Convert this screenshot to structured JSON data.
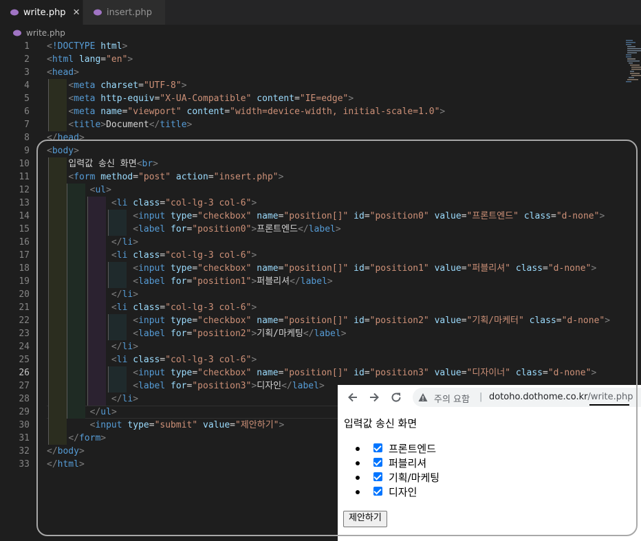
{
  "tabs": [
    {
      "label": "write.php",
      "active": true
    },
    {
      "label": "insert.php",
      "active": false
    }
  ],
  "breadcrumb": "write.php",
  "code": [
    [
      [
        "p",
        "<"
      ],
      [
        "t",
        "!DOCTYPE"
      ],
      [
        "x",
        " "
      ],
      [
        "a",
        "html"
      ],
      [
        "p",
        ">"
      ]
    ],
    [
      [
        "p",
        "<"
      ],
      [
        "t",
        "html"
      ],
      [
        "x",
        " "
      ],
      [
        "a",
        "lang"
      ],
      [
        "x",
        "="
      ],
      [
        "s",
        "\"en\""
      ],
      [
        "p",
        ">"
      ]
    ],
    [
      [
        "p",
        "<"
      ],
      [
        "t",
        "head"
      ],
      [
        "p",
        ">"
      ]
    ],
    [
      [
        "x",
        "    "
      ],
      [
        "p",
        "<"
      ],
      [
        "t",
        "meta"
      ],
      [
        "x",
        " "
      ],
      [
        "a",
        "charset"
      ],
      [
        "x",
        "="
      ],
      [
        "s",
        "\"UTF-8\""
      ],
      [
        "p",
        ">"
      ]
    ],
    [
      [
        "x",
        "    "
      ],
      [
        "p",
        "<"
      ],
      [
        "t",
        "meta"
      ],
      [
        "x",
        " "
      ],
      [
        "a",
        "http-equiv"
      ],
      [
        "x",
        "="
      ],
      [
        "s",
        "\"X-UA-Compatible\""
      ],
      [
        "x",
        " "
      ],
      [
        "a",
        "content"
      ],
      [
        "x",
        "="
      ],
      [
        "s",
        "\"IE=edge\""
      ],
      [
        "p",
        ">"
      ]
    ],
    [
      [
        "x",
        "    "
      ],
      [
        "p",
        "<"
      ],
      [
        "t",
        "meta"
      ],
      [
        "x",
        " "
      ],
      [
        "a",
        "name"
      ],
      [
        "x",
        "="
      ],
      [
        "s",
        "\"viewport\""
      ],
      [
        "x",
        " "
      ],
      [
        "a",
        "content"
      ],
      [
        "x",
        "="
      ],
      [
        "s",
        "\"width=device-width, initial-scale=1.0\""
      ],
      [
        "p",
        ">"
      ]
    ],
    [
      [
        "x",
        "    "
      ],
      [
        "p",
        "<"
      ],
      [
        "t",
        "title"
      ],
      [
        "p",
        ">"
      ],
      [
        "x",
        "Document"
      ],
      [
        "p",
        "</"
      ],
      [
        "t",
        "title"
      ],
      [
        "p",
        ">"
      ]
    ],
    [
      [
        "p",
        "</"
      ],
      [
        "t",
        "head"
      ],
      [
        "p",
        ">"
      ]
    ],
    [
      [
        "p",
        "<"
      ],
      [
        "t",
        "body"
      ],
      [
        "p",
        ">"
      ]
    ],
    [
      [
        "x",
        "    입력값 송신 화면"
      ],
      [
        "p",
        "<"
      ],
      [
        "t",
        "br"
      ],
      [
        "p",
        ">"
      ]
    ],
    [
      [
        "x",
        "    "
      ],
      [
        "p",
        "<"
      ],
      [
        "t",
        "form"
      ],
      [
        "x",
        " "
      ],
      [
        "a",
        "method"
      ],
      [
        "x",
        "="
      ],
      [
        "s",
        "\"post\""
      ],
      [
        "x",
        " "
      ],
      [
        "a",
        "action"
      ],
      [
        "x",
        "="
      ],
      [
        "s",
        "\"insert.php\""
      ],
      [
        "p",
        ">"
      ]
    ],
    [
      [
        "x",
        "        "
      ],
      [
        "p",
        "<"
      ],
      [
        "t",
        "ul"
      ],
      [
        "p",
        ">"
      ]
    ],
    [
      [
        "x",
        "            "
      ],
      [
        "p",
        "<"
      ],
      [
        "t",
        "li"
      ],
      [
        "x",
        " "
      ],
      [
        "a",
        "class"
      ],
      [
        "x",
        "="
      ],
      [
        "s",
        "\"col-lg-3 col-6\""
      ],
      [
        "p",
        ">"
      ]
    ],
    [
      [
        "x",
        "                "
      ],
      [
        "p",
        "<"
      ],
      [
        "t",
        "input"
      ],
      [
        "x",
        " "
      ],
      [
        "a",
        "type"
      ],
      [
        "x",
        "="
      ],
      [
        "s",
        "\"checkbox\""
      ],
      [
        "x",
        " "
      ],
      [
        "a",
        "name"
      ],
      [
        "x",
        "="
      ],
      [
        "s",
        "\"position[]\""
      ],
      [
        "x",
        " "
      ],
      [
        "a",
        "id"
      ],
      [
        "x",
        "="
      ],
      [
        "s",
        "\"position0\""
      ],
      [
        "x",
        " "
      ],
      [
        "a",
        "value"
      ],
      [
        "x",
        "="
      ],
      [
        "s",
        "\"프론트엔드\""
      ],
      [
        "x",
        " "
      ],
      [
        "a",
        "class"
      ],
      [
        "x",
        "="
      ],
      [
        "s",
        "\"d-none\""
      ],
      [
        "p",
        ">"
      ]
    ],
    [
      [
        "x",
        "                "
      ],
      [
        "p",
        "<"
      ],
      [
        "t",
        "label"
      ],
      [
        "x",
        " "
      ],
      [
        "a",
        "for"
      ],
      [
        "x",
        "="
      ],
      [
        "s",
        "\"position0\""
      ],
      [
        "p",
        ">"
      ],
      [
        "x",
        "프론트엔드"
      ],
      [
        "p",
        "</"
      ],
      [
        "t",
        "label"
      ],
      [
        "p",
        ">"
      ]
    ],
    [
      [
        "x",
        "            "
      ],
      [
        "p",
        "</"
      ],
      [
        "t",
        "li"
      ],
      [
        "p",
        ">"
      ]
    ],
    [
      [
        "x",
        "            "
      ],
      [
        "p",
        "<"
      ],
      [
        "t",
        "li"
      ],
      [
        "x",
        " "
      ],
      [
        "a",
        "class"
      ],
      [
        "x",
        "="
      ],
      [
        "s",
        "\"col-lg-3 col-6\""
      ],
      [
        "p",
        ">"
      ]
    ],
    [
      [
        "x",
        "                "
      ],
      [
        "p",
        "<"
      ],
      [
        "t",
        "input"
      ],
      [
        "x",
        " "
      ],
      [
        "a",
        "type"
      ],
      [
        "x",
        "="
      ],
      [
        "s",
        "\"checkbox\""
      ],
      [
        "x",
        " "
      ],
      [
        "a",
        "name"
      ],
      [
        "x",
        "="
      ],
      [
        "s",
        "\"position[]\""
      ],
      [
        "x",
        " "
      ],
      [
        "a",
        "id"
      ],
      [
        "x",
        "="
      ],
      [
        "s",
        "\"position1\""
      ],
      [
        "x",
        " "
      ],
      [
        "a",
        "value"
      ],
      [
        "x",
        "="
      ],
      [
        "s",
        "\"퍼블리셔\""
      ],
      [
        "x",
        " "
      ],
      [
        "a",
        "class"
      ],
      [
        "x",
        "="
      ],
      [
        "s",
        "\"d-none\""
      ],
      [
        "p",
        ">"
      ]
    ],
    [
      [
        "x",
        "                "
      ],
      [
        "p",
        "<"
      ],
      [
        "t",
        "label"
      ],
      [
        "x",
        " "
      ],
      [
        "a",
        "for"
      ],
      [
        "x",
        "="
      ],
      [
        "s",
        "\"position1\""
      ],
      [
        "p",
        ">"
      ],
      [
        "x",
        "퍼블리셔"
      ],
      [
        "p",
        "</"
      ],
      [
        "t",
        "label"
      ],
      [
        "p",
        ">"
      ]
    ],
    [
      [
        "x",
        "            "
      ],
      [
        "p",
        "</"
      ],
      [
        "t",
        "li"
      ],
      [
        "p",
        ">"
      ]
    ],
    [
      [
        "x",
        "            "
      ],
      [
        "p",
        "<"
      ],
      [
        "t",
        "li"
      ],
      [
        "x",
        " "
      ],
      [
        "a",
        "class"
      ],
      [
        "x",
        "="
      ],
      [
        "s",
        "\"col-lg-3 col-6\""
      ],
      [
        "p",
        ">"
      ]
    ],
    [
      [
        "x",
        "                "
      ],
      [
        "p",
        "<"
      ],
      [
        "t",
        "input"
      ],
      [
        "x",
        " "
      ],
      [
        "a",
        "type"
      ],
      [
        "x",
        "="
      ],
      [
        "s",
        "\"checkbox\""
      ],
      [
        "x",
        " "
      ],
      [
        "a",
        "name"
      ],
      [
        "x",
        "="
      ],
      [
        "s",
        "\"position[]\""
      ],
      [
        "x",
        " "
      ],
      [
        "a",
        "id"
      ],
      [
        "x",
        "="
      ],
      [
        "s",
        "\"position2\""
      ],
      [
        "x",
        " "
      ],
      [
        "a",
        "value"
      ],
      [
        "x",
        "="
      ],
      [
        "s",
        "\"기획/마케터\""
      ],
      [
        "x",
        " "
      ],
      [
        "a",
        "class"
      ],
      [
        "x",
        "="
      ],
      [
        "s",
        "\"d-none\""
      ],
      [
        "p",
        ">"
      ]
    ],
    [
      [
        "x",
        "                "
      ],
      [
        "p",
        "<"
      ],
      [
        "t",
        "label"
      ],
      [
        "x",
        " "
      ],
      [
        "a",
        "for"
      ],
      [
        "x",
        "="
      ],
      [
        "s",
        "\"position2\""
      ],
      [
        "p",
        ">"
      ],
      [
        "x",
        "기획/마케팅"
      ],
      [
        "p",
        "</"
      ],
      [
        "t",
        "label"
      ],
      [
        "p",
        ">"
      ]
    ],
    [
      [
        "x",
        "            "
      ],
      [
        "p",
        "</"
      ],
      [
        "t",
        "li"
      ],
      [
        "p",
        ">"
      ]
    ],
    [
      [
        "x",
        "            "
      ],
      [
        "p",
        "<"
      ],
      [
        "t",
        "li"
      ],
      [
        "x",
        " "
      ],
      [
        "a",
        "class"
      ],
      [
        "x",
        "="
      ],
      [
        "s",
        "\"col-lg-3 col-6\""
      ],
      [
        "p",
        ">"
      ]
    ],
    [
      [
        "x",
        "                "
      ],
      [
        "p",
        "<"
      ],
      [
        "t",
        "input"
      ],
      [
        "x",
        " "
      ],
      [
        "a",
        "type"
      ],
      [
        "x",
        "="
      ],
      [
        "s",
        "\"checkbox\""
      ],
      [
        "x",
        " "
      ],
      [
        "a",
        "name"
      ],
      [
        "x",
        "="
      ],
      [
        "s",
        "\"position[]\""
      ],
      [
        "x",
        " "
      ],
      [
        "a",
        "id"
      ],
      [
        "x",
        "="
      ],
      [
        "s",
        "\"position3\""
      ],
      [
        "x",
        " "
      ],
      [
        "a",
        "value"
      ],
      [
        "x",
        "="
      ],
      [
        "s",
        "\"디자이너\""
      ],
      [
        "x",
        " "
      ],
      [
        "a",
        "class"
      ],
      [
        "x",
        "="
      ],
      [
        "s",
        "\"d-none\""
      ],
      [
        "p",
        ">"
      ]
    ],
    [
      [
        "x",
        "                "
      ],
      [
        "p",
        "<"
      ],
      [
        "t",
        "label"
      ],
      [
        "x",
        " "
      ],
      [
        "a",
        "for"
      ],
      [
        "x",
        "="
      ],
      [
        "s",
        "\"position3\""
      ],
      [
        "p",
        ">"
      ],
      [
        "x",
        "디자인"
      ],
      [
        "p",
        "</"
      ],
      [
        "t",
        "label"
      ],
      [
        "p",
        ">"
      ]
    ],
    [
      [
        "x",
        "            "
      ],
      [
        "p",
        "</"
      ],
      [
        "t",
        "li"
      ],
      [
        "p",
        ">"
      ]
    ],
    [
      [
        "x",
        "        "
      ],
      [
        "p",
        "</"
      ],
      [
        "t",
        "ul"
      ],
      [
        "p",
        ">"
      ]
    ],
    [
      [
        "x",
        "        "
      ],
      [
        "p",
        "<"
      ],
      [
        "t",
        "input"
      ],
      [
        "x",
        " "
      ],
      [
        "a",
        "type"
      ],
      [
        "x",
        "="
      ],
      [
        "s",
        "\"submit\""
      ],
      [
        "x",
        " "
      ],
      [
        "a",
        "value"
      ],
      [
        "x",
        "="
      ],
      [
        "s",
        "\"제안하기\""
      ],
      [
        "p",
        ">"
      ]
    ],
    [
      [
        "x",
        "    "
      ],
      [
        "p",
        "</"
      ],
      [
        "t",
        "form"
      ],
      [
        "p",
        ">"
      ]
    ],
    [
      [
        "p",
        "</"
      ],
      [
        "t",
        "body"
      ],
      [
        "p",
        ">"
      ]
    ],
    [
      [
        "p",
        "</"
      ],
      [
        "t",
        "html"
      ],
      [
        "p",
        ">"
      ]
    ]
  ],
  "current_line": 26,
  "browser": {
    "security_label": "주의 요함",
    "separator": "|",
    "url_host": "dotoho.dothome.co.kr",
    "url_path": "/write.php",
    "page_text": "입력값 송신 화면",
    "positions": [
      {
        "label": "프론트엔드",
        "checked": true
      },
      {
        "label": "퍼블리셔",
        "checked": true
      },
      {
        "label": "기획/마케팅",
        "checked": true
      },
      {
        "label": "디자인",
        "checked": true
      }
    ],
    "submit_label": "제안하기"
  },
  "colors": {
    "editor_bg": "#1e1e1e",
    "tag": "#569cd6",
    "attribute": "#9cdcfe",
    "string": "#ce9178",
    "punctuation": "#808080",
    "text": "#d4d4d4",
    "checkbox": "#0075ff"
  },
  "icons": [
    "php-elephant-icon",
    "close-icon",
    "back-arrow-icon",
    "forward-arrow-icon",
    "reload-icon",
    "warning-icon"
  ]
}
